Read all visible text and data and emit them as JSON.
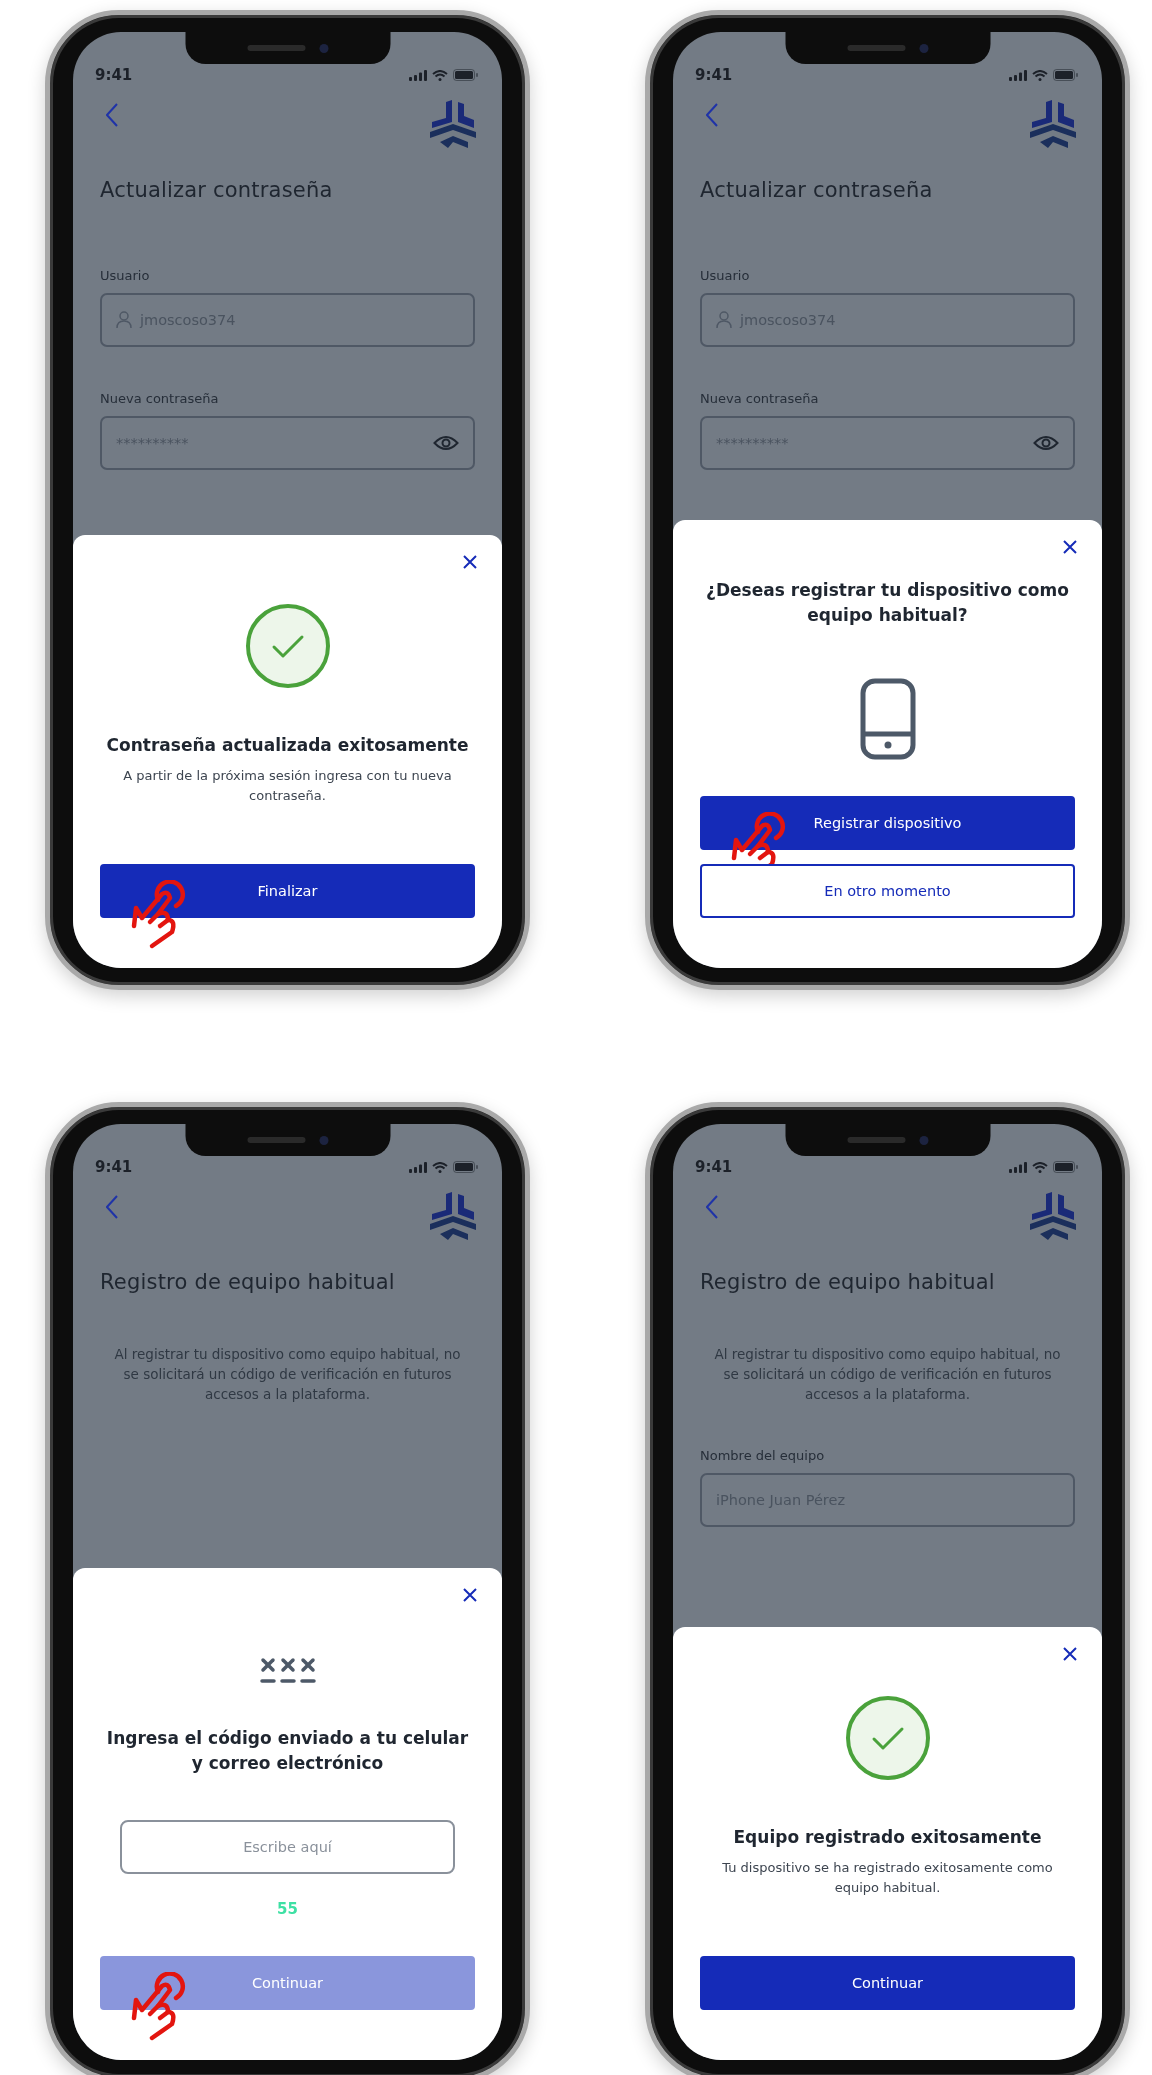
{
  "screens": [
    {
      "time": "9:41",
      "title": "Actualizar contraseña",
      "fields": [
        {
          "label": "Usuario",
          "value": "jmoscoso374",
          "kind": "username"
        },
        {
          "label": "Nueva contraseña",
          "value": "**********",
          "kind": "password"
        }
      ],
      "sheet": {
        "kind": "success",
        "title": "Contraseña actualizada exitosamente",
        "message": "A partir de la próxima sesión ingresa con tu nueva contraseña.",
        "buttons": [
          {
            "label": "Finalizar",
            "kind": "primary",
            "disabled": false,
            "tapped": true
          }
        ]
      }
    },
    {
      "time": "9:41",
      "title": "Actualizar contraseña",
      "fields": [
        {
          "label": "Usuario",
          "value": "jmoscoso374",
          "kind": "username"
        },
        {
          "label": "Nueva contraseña",
          "value": "**********",
          "kind": "password"
        }
      ],
      "sheet": {
        "kind": "confirm",
        "title": "¿Deseas registrar tu dispositivo como equipo habitual?",
        "buttons": [
          {
            "label": "Registrar dispositivo",
            "kind": "primary",
            "disabled": false,
            "tapped": true
          },
          {
            "label": "En otro momento",
            "kind": "outline",
            "disabled": false,
            "tapped": false
          }
        ]
      }
    },
    {
      "time": "9:41",
      "title": "Registro de equipo habitual",
      "intro": "Al registrar tu dispositivo como equipo habitual, no se solicitará un código de verificación en futuros accesos a la plataforma.",
      "sheet": {
        "kind": "code",
        "title": "Ingresa el código enviado a tu celular y correo electrónico",
        "placeholder": "Escribe aquí",
        "countdown": "55",
        "buttons": [
          {
            "label": "Continuar",
            "kind": "primary",
            "disabled": true,
            "tapped": true
          }
        ]
      }
    },
    {
      "time": "9:41",
      "title": "Registro de equipo habitual",
      "intro": "Al registrar tu dispositivo como equipo habitual, no se solicitará un código de verificación en futuros accesos a la plataforma.",
      "fields": [
        {
          "label": "Nombre del equipo",
          "value": "iPhone Juan Pérez",
          "kind": "text"
        }
      ],
      "sheet": {
        "kind": "success",
        "title": "Equipo registrado exitosamente",
        "message": "Tu dispositivo se ha registrado exitosamente como equipo habitual.",
        "buttons": [
          {
            "label": "Continuar",
            "kind": "primary",
            "disabled": false,
            "tapped": false
          }
        ]
      }
    }
  ]
}
